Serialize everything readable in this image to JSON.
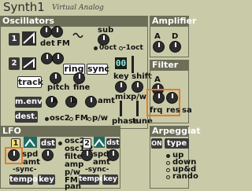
{
  "header": {
    "title": "Synth1",
    "subtitle": "Virtual Analog"
  },
  "oscillators": {
    "title": "Oscillators",
    "osc1_num": "1",
    "osc2_num": "2",
    "det_label": "det",
    "fm_label": "FM",
    "sub_label": "sub",
    "oct_label": "0oct",
    "loct_label": "-1oct",
    "track_label": "track",
    "ring_label": "ring",
    "sync_label": "sync",
    "pitch_label": "pitch",
    "fine_label": "fine",
    "menv_label": "m.env",
    "dest_label": "dest.",
    "a_label": "A",
    "d_label": "D",
    "amt_label": "amt",
    "osc2_label": "osc2",
    "fm2_label": "FM",
    "pw_label": "p/w",
    "keyshift_value": "00",
    "keyshift_label": "key shift",
    "mix_label": "mix",
    "pw2_label": "p/w",
    "phase_label": "phase",
    "tune_label": "tune"
  },
  "amplifier": {
    "title": "Amplifier",
    "a": "A",
    "d": "D"
  },
  "filter": {
    "title": "Filter",
    "a": "A",
    "frq": "frq",
    "res": "res",
    "sat": "sa"
  },
  "lfo": {
    "title": "LFO",
    "num": "1",
    "dst": "dst",
    "spd": "spd",
    "amt": "amt",
    "sync": "-sync-",
    "tempo": "tempo",
    "key": "key",
    "dst_options": [
      "osc2",
      "osc1,2",
      "filter",
      "amp",
      "p/w",
      "FM",
      "pan"
    ],
    "num2": "2",
    "dst2": "dst",
    "spd2": "spd",
    "amt2": "amt",
    "sync2": "-sync-",
    "tempo2": "tempo",
    "key2": "key"
  },
  "arpeggiator": {
    "title": "Arpeggiat",
    "on": "ON",
    "type": "type",
    "options": [
      "up",
      "down",
      "up&d",
      "rando"
    ]
  },
  "colors": {
    "panel_bg": "#c9caa8",
    "header_bg": "#6d6e58",
    "highlight": "#e77a2a",
    "lcd_text": "#8ef0e0"
  }
}
